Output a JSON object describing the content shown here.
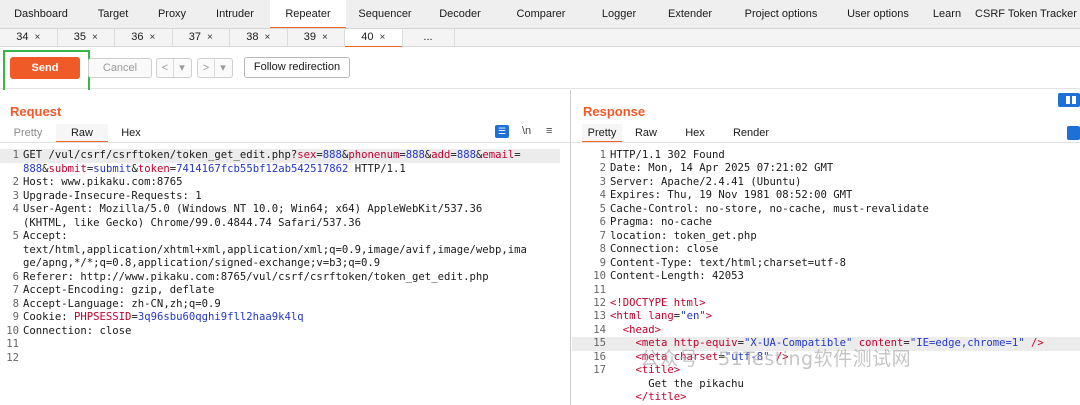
{
  "top_tabs": [
    {
      "label": "Dashboard",
      "active": false
    },
    {
      "label": "Target",
      "active": false
    },
    {
      "label": "Proxy",
      "active": false
    },
    {
      "label": "Intruder",
      "active": false
    },
    {
      "label": "Repeater",
      "active": true
    },
    {
      "label": "Sequencer",
      "active": false
    },
    {
      "label": "Decoder",
      "active": false
    },
    {
      "label": "Comparer",
      "active": false
    },
    {
      "label": "Logger",
      "active": false
    },
    {
      "label": "Extender",
      "active": false
    },
    {
      "label": "Project options",
      "active": false
    },
    {
      "label": "User options",
      "active": false
    },
    {
      "label": "Learn",
      "active": false
    },
    {
      "label": "CSRF Token Tracker",
      "active": false
    }
  ],
  "sub_tabs": [
    {
      "label": "34",
      "close": "×",
      "active": false
    },
    {
      "label": "35",
      "close": "×",
      "active": false
    },
    {
      "label": "36",
      "close": "×",
      "active": false
    },
    {
      "label": "37",
      "close": "×",
      "active": false
    },
    {
      "label": "38",
      "close": "×",
      "active": false
    },
    {
      "label": "39",
      "close": "×",
      "active": false
    },
    {
      "label": "40",
      "close": "×",
      "active": true
    },
    {
      "label": "...",
      "close": "",
      "active": false
    }
  ],
  "toolbar": {
    "send_label": "Send",
    "cancel_label": "Cancel",
    "back": "<",
    "back_menu": "▾",
    "forward": ">",
    "forward_menu": "▾",
    "follow_label": "Follow redirection"
  },
  "request": {
    "title": "Request",
    "tabs": [
      "Pretty",
      "Raw",
      "Hex"
    ],
    "active_tab": "Raw",
    "icons": {
      "wrap": "\\n",
      "menu": "≡"
    },
    "lines": [
      {
        "n": "1",
        "segments": [
          {
            "t": "GET /vul/csrf/csrftoken/token_get_edit.php?",
            "c": "dark"
          },
          {
            "t": "sex",
            "c": "red"
          },
          {
            "t": "=",
            "c": "dark"
          },
          {
            "t": "888",
            "c": "blue"
          },
          {
            "t": "&",
            "c": "dark"
          },
          {
            "t": "phonenum",
            "c": "red"
          },
          {
            "t": "=",
            "c": "dark"
          },
          {
            "t": "888",
            "c": "blue"
          },
          {
            "t": "&",
            "c": "dark"
          },
          {
            "t": "add",
            "c": "red"
          },
          {
            "t": "=",
            "c": "dark"
          },
          {
            "t": "888",
            "c": "blue"
          },
          {
            "t": "&",
            "c": "dark"
          },
          {
            "t": "email",
            "c": "red"
          },
          {
            "t": "=",
            "c": "dark"
          }
        ]
      },
      {
        "n": "",
        "segments": [
          {
            "t": "888",
            "c": "blue"
          },
          {
            "t": "&",
            "c": "dark"
          },
          {
            "t": "submit",
            "c": "red"
          },
          {
            "t": "=",
            "c": "dark"
          },
          {
            "t": "submit",
            "c": "blue"
          },
          {
            "t": "&",
            "c": "dark"
          },
          {
            "t": "token",
            "c": "red"
          },
          {
            "t": "=",
            "c": "dark"
          },
          {
            "t": "7414167fcb55bf12ab542517862",
            "c": "blue"
          },
          {
            "t": " HTTP/1.1",
            "c": "dark"
          }
        ]
      },
      {
        "n": "2",
        "segments": [
          {
            "t": "Host: www.pikaku.com:8765",
            "c": "dark"
          }
        ]
      },
      {
        "n": "3",
        "segments": [
          {
            "t": "Upgrade-Insecure-Requests: 1",
            "c": "dark"
          }
        ]
      },
      {
        "n": "4",
        "segments": [
          {
            "t": "User-Agent: Mozilla/5.0 (Windows NT 10.0; Win64; x64) AppleWebKit/537.36",
            "c": "dark"
          }
        ]
      },
      {
        "n": "",
        "segments": [
          {
            "t": "(KHTML, like Gecko) Chrome/99.0.4844.74 Safari/537.36",
            "c": "dark"
          }
        ]
      },
      {
        "n": "5",
        "segments": [
          {
            "t": "Accept:",
            "c": "dark"
          }
        ]
      },
      {
        "n": "",
        "segments": [
          {
            "t": "text/html,application/xhtml+xml,application/xml;q=0.9,image/avif,image/webp,ima",
            "c": "dark"
          }
        ]
      },
      {
        "n": "",
        "segments": [
          {
            "t": "ge/apng,*/*;q=0.8,application/signed-exchange;v=b3;q=0.9",
            "c": "dark"
          }
        ]
      },
      {
        "n": "6",
        "segments": [
          {
            "t": "Referer: http://www.pikaku.com:8765/vul/csrf/csrftoken/token_get_edit.php",
            "c": "dark"
          }
        ]
      },
      {
        "n": "7",
        "segments": [
          {
            "t": "Accept-Encoding: gzip, deflate",
            "c": "dark"
          }
        ]
      },
      {
        "n": "8",
        "segments": [
          {
            "t": "Accept-Language: zh-CN,zh;q=0.9",
            "c": "dark"
          }
        ]
      },
      {
        "n": "9",
        "segments": [
          {
            "t": "Cookie: ",
            "c": "dark"
          },
          {
            "t": "PHPSESSID",
            "c": "red"
          },
          {
            "t": "=",
            "c": "dark"
          },
          {
            "t": "3q96sbu60qghi9fll2haa9k4lq",
            "c": "blue"
          }
        ]
      },
      {
        "n": "10",
        "segments": [
          {
            "t": "Connection: close",
            "c": "dark"
          }
        ]
      },
      {
        "n": "11",
        "segments": [
          {
            "t": "",
            "c": "dark"
          }
        ]
      },
      {
        "n": "12",
        "segments": [
          {
            "t": "",
            "c": "dark"
          }
        ]
      }
    ]
  },
  "response": {
    "title": "Response",
    "tabs": [
      "Pretty",
      "Raw",
      "Hex",
      "Render"
    ],
    "active_tab": "Pretty",
    "lines": [
      {
        "n": "1",
        "segments": [
          {
            "t": "HTTP/1.1 302 Found",
            "c": "dark"
          }
        ]
      },
      {
        "n": "2",
        "segments": [
          {
            "t": "Date: Mon, 14 Apr 2025 07:21:02 GMT",
            "c": "dark"
          }
        ]
      },
      {
        "n": "3",
        "segments": [
          {
            "t": "Server: Apache/2.4.41 (Ubuntu)",
            "c": "dark"
          }
        ]
      },
      {
        "n": "4",
        "segments": [
          {
            "t": "Expires: Thu, 19 Nov 1981 08:52:00 GMT",
            "c": "dark"
          }
        ]
      },
      {
        "n": "5",
        "segments": [
          {
            "t": "Cache-Control: no-store, no-cache, must-revalidate",
            "c": "dark"
          }
        ]
      },
      {
        "n": "6",
        "segments": [
          {
            "t": "Pragma: no-cache",
            "c": "dark"
          }
        ]
      },
      {
        "n": "7",
        "segments": [
          {
            "t": "location: token_get.php",
            "c": "dark"
          }
        ]
      },
      {
        "n": "8",
        "segments": [
          {
            "t": "Connection: close",
            "c": "dark"
          }
        ]
      },
      {
        "n": "9",
        "segments": [
          {
            "t": "Content-Type: text/html;charset=utf-8",
            "c": "dark"
          }
        ]
      },
      {
        "n": "10",
        "segments": [
          {
            "t": "Content-Length: 42053",
            "c": "dark"
          }
        ]
      },
      {
        "n": "11",
        "segments": [
          {
            "t": "",
            "c": "dark"
          }
        ]
      },
      {
        "n": "12",
        "segments": [
          {
            "t": "<!DOCTYPE html>",
            "c": "red"
          }
        ]
      },
      {
        "n": "13",
        "segments": [
          {
            "t": "<html ",
            "c": "red"
          },
          {
            "t": "lang",
            "c": "red"
          },
          {
            "t": "=",
            "c": "dark"
          },
          {
            "t": "\"en\"",
            "c": "blue"
          },
          {
            "t": ">",
            "c": "red"
          }
        ]
      },
      {
        "n": "14",
        "segments": [
          {
            "t": "  <head>",
            "c": "red"
          }
        ]
      },
      {
        "n": "15",
        "segments": [
          {
            "t": "    <meta ",
            "c": "red"
          },
          {
            "t": "http-equiv",
            "c": "red"
          },
          {
            "t": "=",
            "c": "dark"
          },
          {
            "t": "\"X-UA-Compatible\"",
            "c": "blue"
          },
          {
            "t": " content",
            "c": "red"
          },
          {
            "t": "=",
            "c": "dark"
          },
          {
            "t": "\"IE=edge,chrome=1\"",
            "c": "blue"
          },
          {
            "t": " />",
            "c": "red"
          }
        ]
      },
      {
        "n": "16",
        "segments": [
          {
            "t": "    <meta ",
            "c": "red"
          },
          {
            "t": "charset",
            "c": "red"
          },
          {
            "t": "=",
            "c": "dark"
          },
          {
            "t": "\"utf-8\"",
            "c": "blue"
          },
          {
            "t": " />",
            "c": "red"
          }
        ]
      },
      {
        "n": "17",
        "segments": [
          {
            "t": "    <title>",
            "c": "red"
          }
        ]
      },
      {
        "n": "",
        "segments": [
          {
            "t": "      Get the pikachu",
            "c": "dark"
          }
        ]
      },
      {
        "n": "",
        "segments": [
          {
            "t": "    </title>",
            "c": "red"
          }
        ]
      }
    ]
  },
  "watermark": "公众号 · 51Testing软件测试网"
}
